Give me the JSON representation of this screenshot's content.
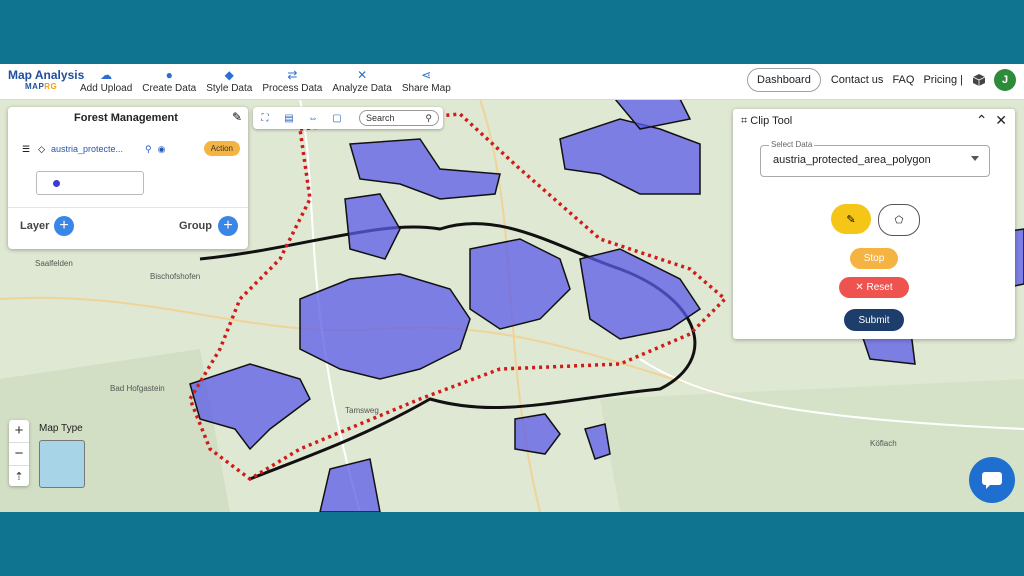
{
  "brand": {
    "title": "Map Analysis",
    "sub1": "MAP",
    "sub2": "RG"
  },
  "nav": [
    {
      "label": "Add Upload",
      "icon": "cloud-upload-icon"
    },
    {
      "label": "Create Data",
      "icon": "location-pin-icon"
    },
    {
      "label": "Style Data",
      "icon": "paint-bucket-icon"
    },
    {
      "label": "Process Data",
      "icon": "process-icon"
    },
    {
      "label": "Analyze Data",
      "icon": "analyze-icon"
    },
    {
      "label": "Share Map",
      "icon": "share-icon"
    }
  ],
  "right_nav": {
    "dashboard": "Dashboard",
    "contact": "Contact us",
    "faq": "FAQ",
    "pricing": "Pricing |",
    "avatar": "J"
  },
  "left_panel": {
    "title": "Forest Management",
    "layer_name": "austria_protecte...",
    "action": "Action",
    "layer_label": "Layer",
    "group_label": "Group"
  },
  "toolbar": {
    "search": "Search"
  },
  "clip_tool": {
    "title": "Clip Tool",
    "select_label": "Select Data",
    "select_value": "austria_protected_area_polygon",
    "stop": "Stop",
    "reset": "Reset",
    "submit": "Submit"
  },
  "map_type": "Map Type",
  "colors": {
    "accent": "#1f4e9c",
    "polygon": "#5b5be8",
    "clip_line": "#d11a1a"
  }
}
